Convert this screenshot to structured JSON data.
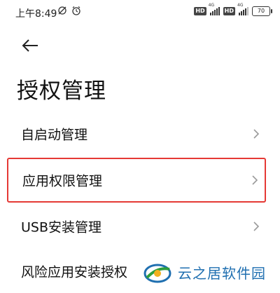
{
  "status_bar": {
    "time": "上午8:49",
    "sim1_badge": "HD",
    "sim1_tag": "4G",
    "sim2_badge": "HD",
    "sim2_tag": "4G",
    "battery": "70"
  },
  "page": {
    "title": "授权管理"
  },
  "menu": {
    "items": [
      {
        "label": "自启动管理"
      },
      {
        "label": "应用权限管理"
      },
      {
        "label": "USB安装管理"
      },
      {
        "label": "风险应用安装授权"
      }
    ]
  },
  "watermark": {
    "text": "云之居软件园"
  },
  "colors": {
    "highlight": "#e53935",
    "watermark_text": "#1f6fb0"
  }
}
